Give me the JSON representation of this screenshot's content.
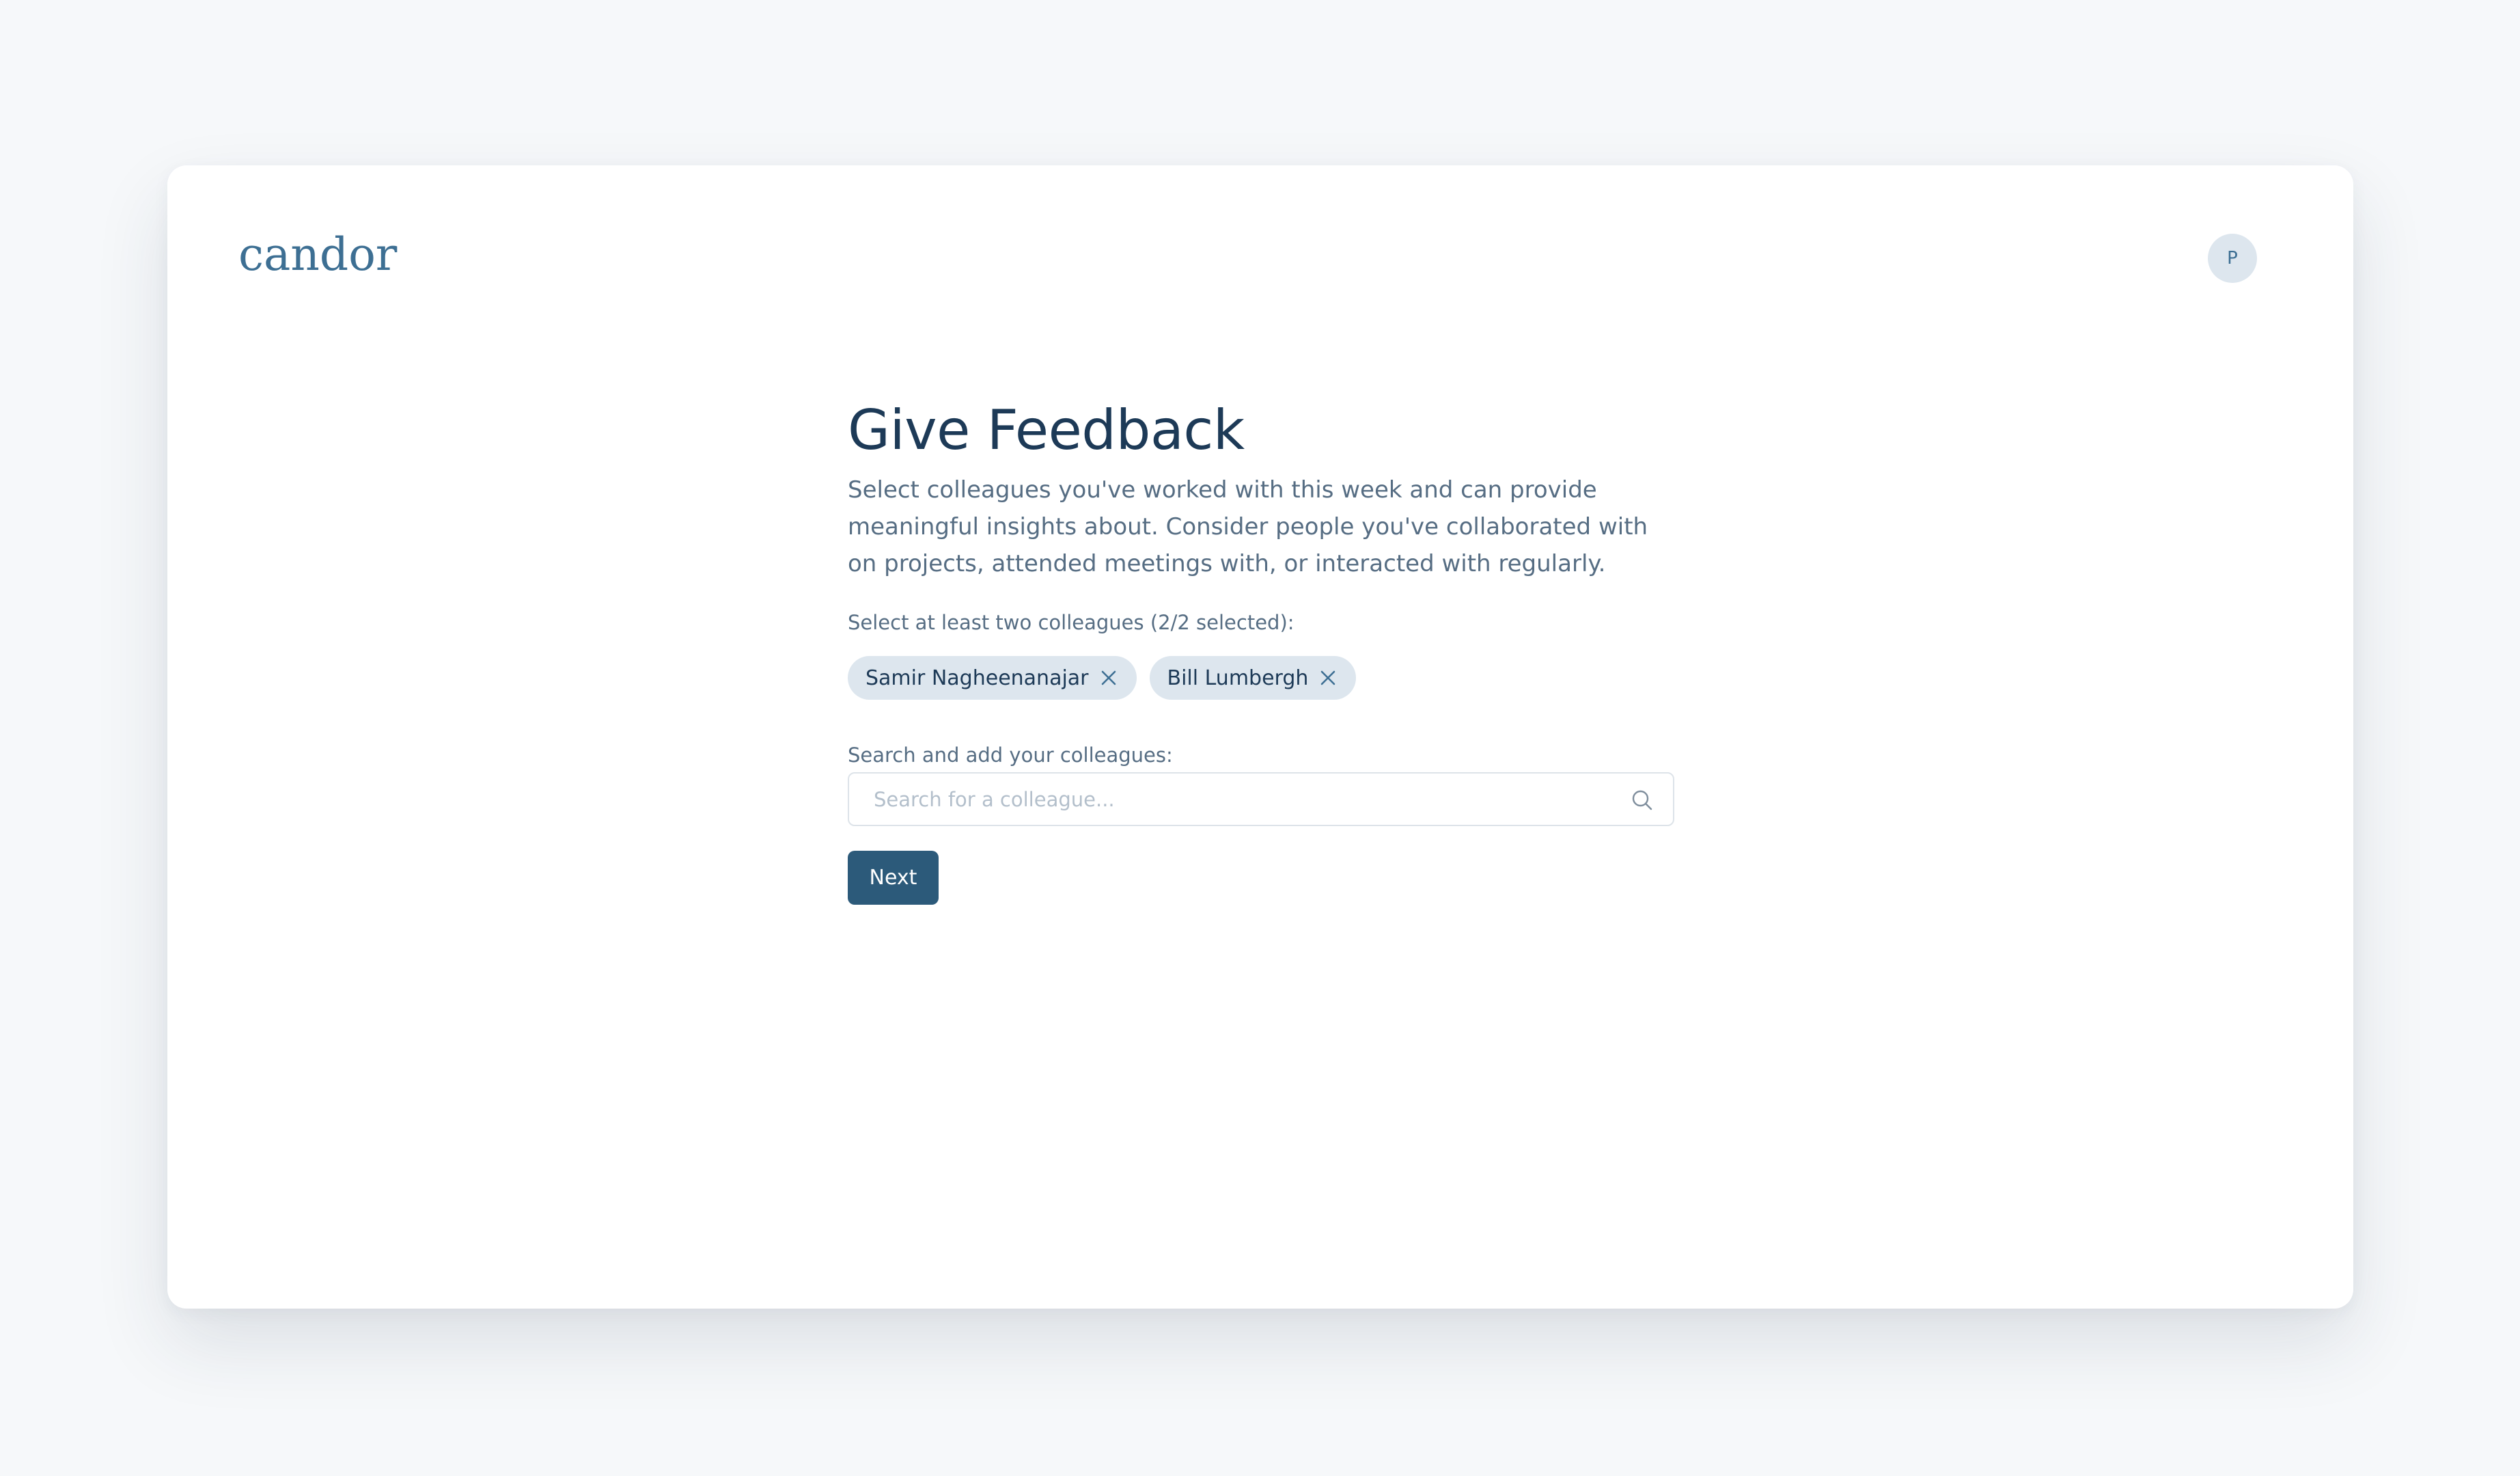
{
  "app": {
    "logo_text": "candor",
    "brand_color": "#3d6f93",
    "avatar_initial": "P"
  },
  "page": {
    "title": "Give Feedback",
    "description": "Select colleagues you've worked with this week and can provide meaningful insights about. Consider people you've collaborated with on projects, attended meetings with, or interacted with regularly.",
    "select_label": "Select at least two colleagues (2/2 selected):",
    "selected_colleagues": [
      {
        "name": "Samir Nagheenanajar",
        "remove_icon": "close-icon"
      },
      {
        "name": "Bill Lumbergh",
        "remove_icon": "close-icon"
      }
    ],
    "search_label": "Search and add your colleagues:",
    "search_placeholder": "Search for a colleague...",
    "search_value": "",
    "search_icon": "search-icon",
    "next_label": "Next",
    "accent_color": "#2c5a7a"
  }
}
